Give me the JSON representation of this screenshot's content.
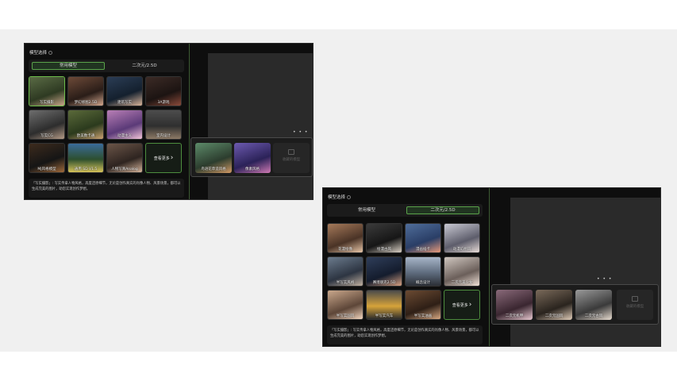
{
  "panels": [
    {
      "title": "模型选择",
      "tabs": [
        {
          "label": "常用模型",
          "active": true
        },
        {
          "label": "二次元/2.5D",
          "active": false
        }
      ],
      "cards": [
        {
          "label": "写实摄影",
          "selected": true
        },
        {
          "label": "梦幻修图2.5D"
        },
        {
          "label": "建筑写实"
        },
        {
          "label": "3A游戏"
        },
        {
          "label": "写实CG"
        },
        {
          "label": "欧美数卡通"
        },
        {
          "label": "动漫主义"
        },
        {
          "label": "室内设计"
        },
        {
          "label": "MJ风格模型"
        },
        {
          "label": "通用 SD V1.5"
        },
        {
          "label": "人物写真Analog"
        }
      ],
      "more_label": "查看更多",
      "description": "「写实摄影」: 写实传拿人物风格，高度还原细节，无论是创作真实的肖像人物、风景场景，都可以生成完美的图片，助您实现创作梦想。",
      "popup": {
        "cards": [
          {
            "label": "鸟语花草造风格"
          },
          {
            "label": "像素风格"
          }
        ],
        "empty_label": "收藏的模型"
      }
    },
    {
      "title": "模型选择",
      "tabs": [
        {
          "label": "常用模型",
          "active": false
        },
        {
          "label": "二次元/2.5D",
          "active": true
        }
      ],
      "cards": [
        {
          "label": "花漫绘像"
        },
        {
          "label": "绘漫古风"
        },
        {
          "label": "漫画插卡"
        },
        {
          "label": "动漫幻想风"
        },
        {
          "label": "半写实风格"
        },
        {
          "label": "赛博朋克2.5D"
        },
        {
          "label": "概念设计"
        },
        {
          "label": "二次元美少女"
        },
        {
          "label": "半写实国风"
        },
        {
          "label": "半写实汽车"
        },
        {
          "label": "半写实油画"
        }
      ],
      "more_label": "查看更多",
      "description": "「写实摄影」: 写实传拿人物风格，高度还原细节，无论是创作真实的肖像人物、风景场景，都可以生成完美的图片，助您实现创作梦想。",
      "popup": {
        "cards": [
          {
            "label": "二次元机甲"
          },
          {
            "label": "二次元国风"
          },
          {
            "label": "二次元古风"
          }
        ],
        "empty_label": "收藏的模型"
      }
    }
  ],
  "pager_dots": "• • •",
  "colors": {
    "accent": "#5aa34a",
    "panel_bg": "#0e0e0e",
    "preview_bg": "#2a2a2a"
  }
}
